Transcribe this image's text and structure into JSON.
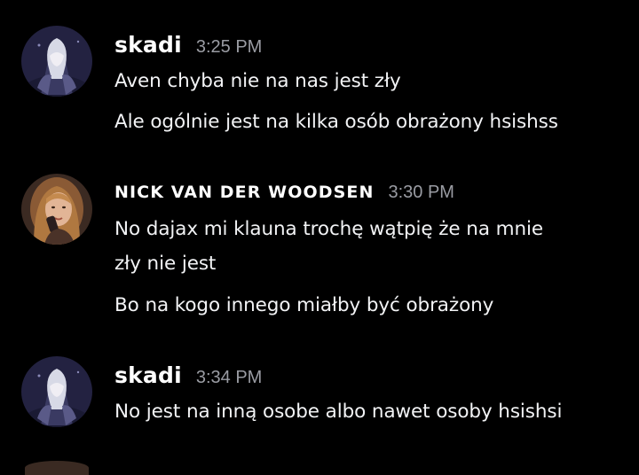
{
  "messages": [
    {
      "author": "skadi",
      "time": "3:25 PM",
      "avatar": "skadi-avatar",
      "lines": [
        "Aven chyba nie na nas jest zły",
        "Ale ogólnie jest na kilka osób obrażony hsishss"
      ]
    },
    {
      "author": "NICK VAN DER WOODSEN",
      "time": "3:30 PM",
      "avatar": "nick-avatar",
      "lines": [
        "No dajax mi klauna trochę wątpię że na mnie",
        "zły nie jest",
        "Bo na kogo innego miałby być obrażony"
      ]
    },
    {
      "author": "skadi",
      "time": "3:34 PM",
      "avatar": "skadi-avatar",
      "lines": [
        "No jest na inną osobe albo nawet osoby hsishsi"
      ]
    }
  ],
  "colors": {
    "background": "#000000",
    "username": "#ffffff",
    "timestamp": "#9a9ca3",
    "message_text": "#f2f3f5"
  }
}
